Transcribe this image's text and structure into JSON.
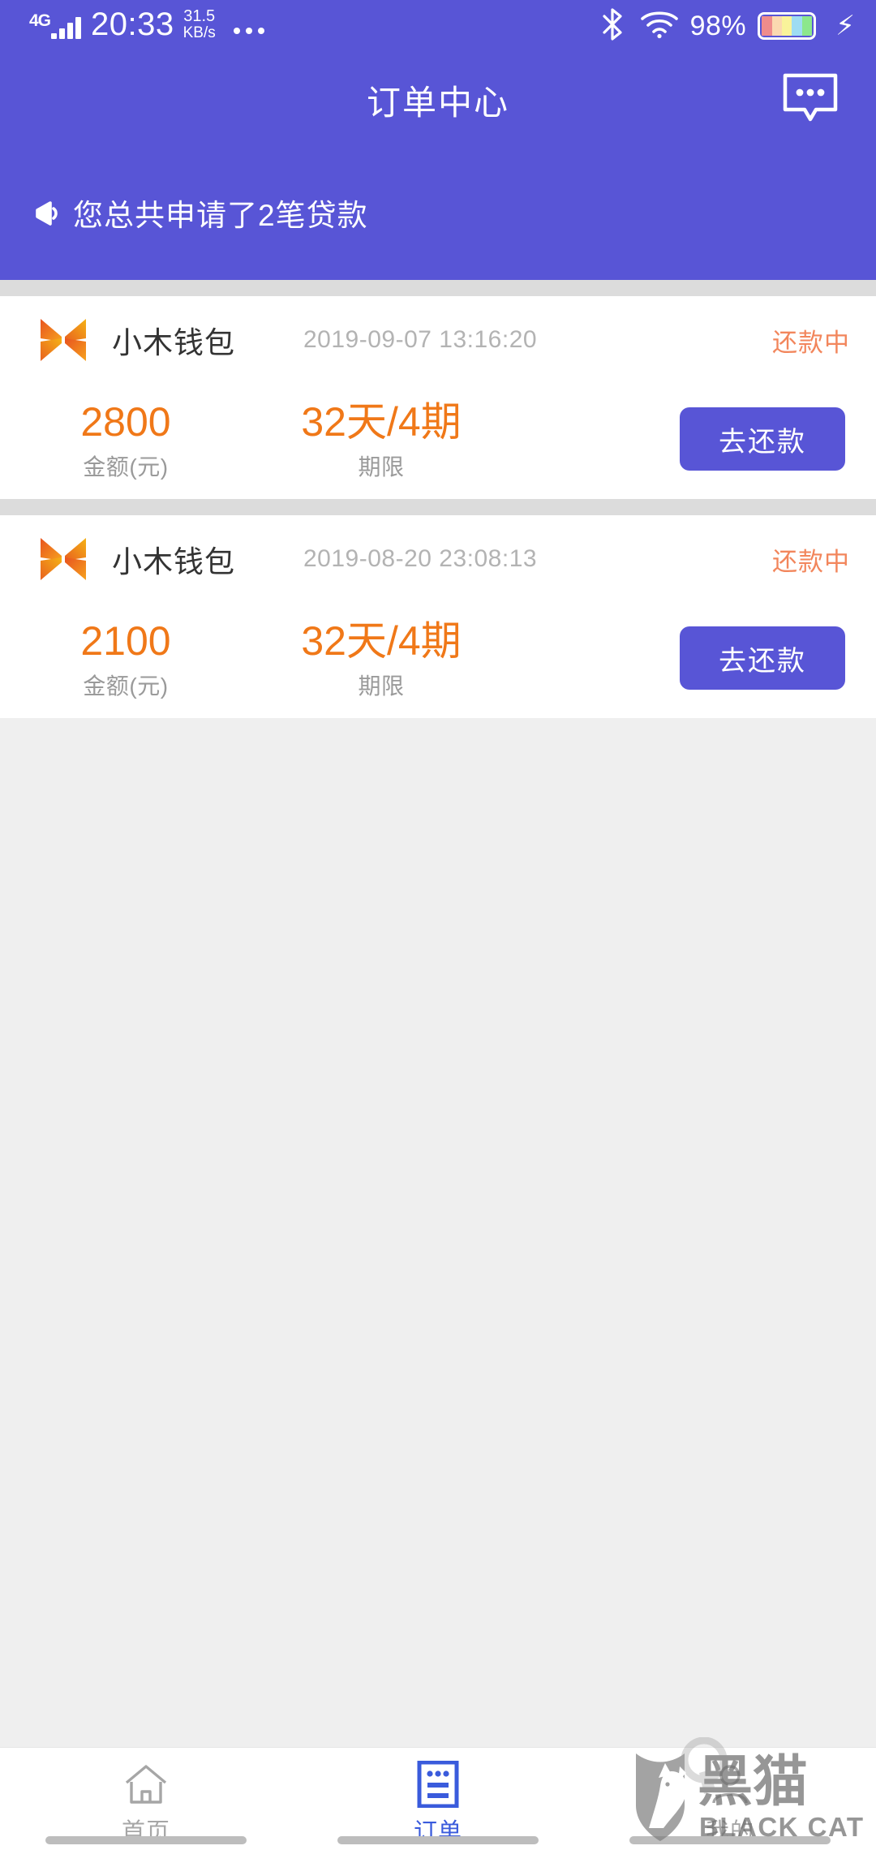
{
  "status_bar": {
    "network_type": "4G",
    "time": "20:33",
    "speed_value": "31.5",
    "speed_unit": "KB/s",
    "overflow_dots": "•••",
    "battery_percent": "98%",
    "icons": {
      "signal": "signal-bars-icon",
      "bluetooth": "bluetooth-icon",
      "wifi": "wifi-icon",
      "battery": "battery-icon",
      "charging": "charging-bolt-icon"
    },
    "background_color": "#5855d6"
  },
  "header": {
    "title": "订单中心",
    "action_icon": "chat-bubble-icon",
    "background_color": "#5855d6",
    "text_color": "#ffffff"
  },
  "notice": {
    "icon": "megaphone-icon",
    "text": "您总共申请了2笔贷款"
  },
  "orders": {
    "amount_label": "金额(元)",
    "term_label": "期限",
    "cta_label": "去还款",
    "items": [
      {
        "brand": "小木钱包",
        "brand_logo": "xiaomu-wallet-logo-icon",
        "time": "2019-09-07 13:16:20",
        "status": "还款中",
        "amount": "2800",
        "term": "32天/4期"
      },
      {
        "brand": "小木钱包",
        "brand_logo": "xiaomu-wallet-logo-icon",
        "time": "2019-08-20 23:08:13",
        "status": "还款中",
        "amount": "2100",
        "term": "32天/4期"
      }
    ]
  },
  "tabbar": {
    "items": [
      {
        "label": "首页",
        "icon": "home-icon",
        "active": false
      },
      {
        "label": "订单",
        "icon": "order-list-icon",
        "active": true
      },
      {
        "label": "我的",
        "icon": "person-icon",
        "active": false
      }
    ]
  },
  "watermark": {
    "cn_text": "黑猫",
    "en_text": "BLACK CAT",
    "icon": "black-cat-shield-icon"
  },
  "colors": {
    "brand_purple": "#5855d6",
    "accent_orange": "#f07818",
    "status_orange": "#f2865c",
    "page_background": "#efefef",
    "card_background": "#ffffff",
    "divider_gray": "#dcdcdc",
    "tab_active_blue": "#3a5bdc",
    "tab_inactive_gray": "#a6a6a6"
  }
}
